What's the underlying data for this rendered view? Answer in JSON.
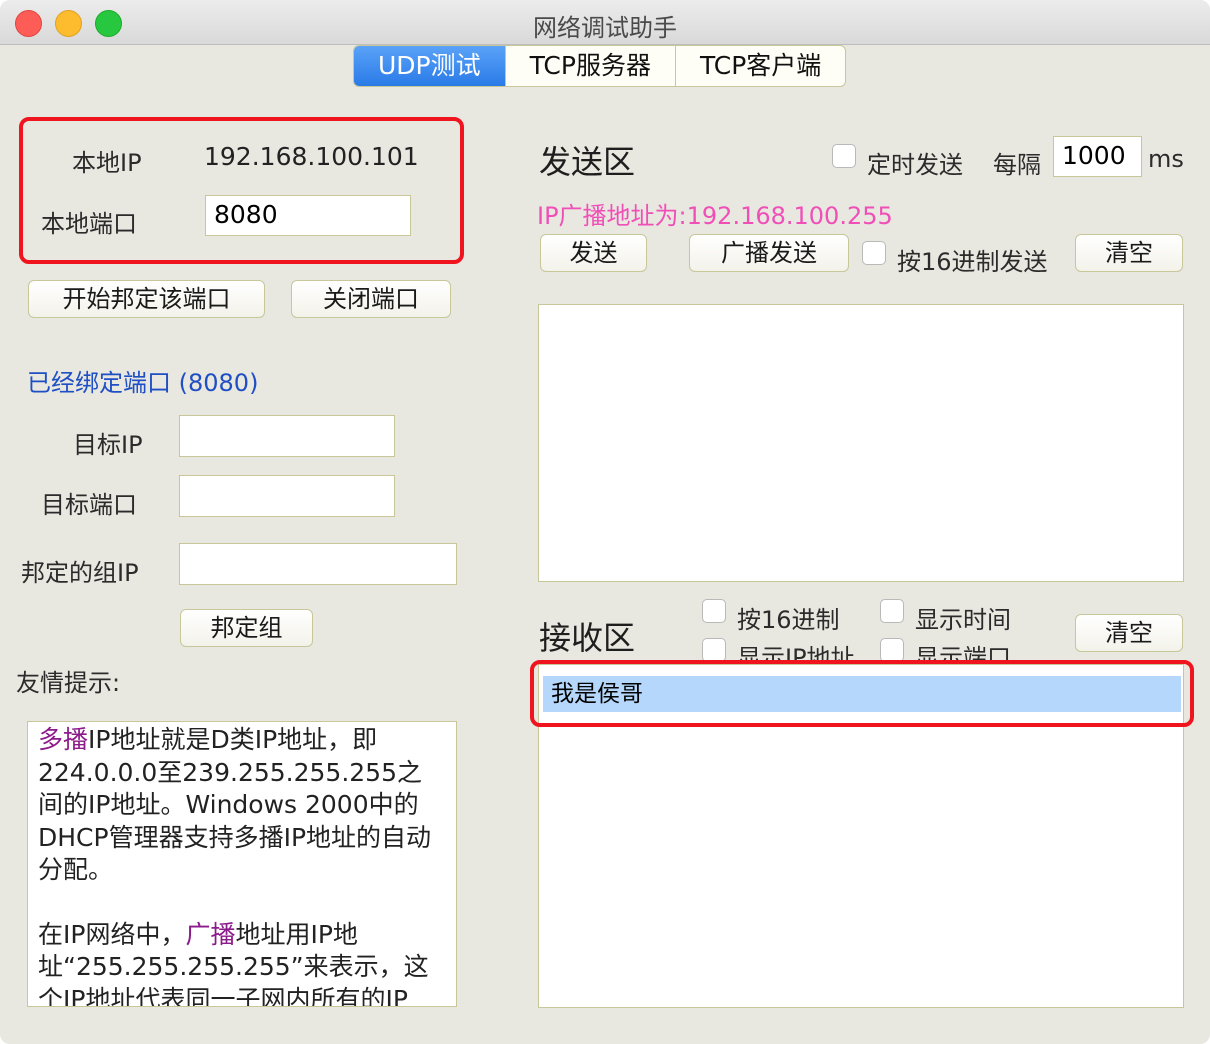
{
  "window": {
    "title": "网络调试助手"
  },
  "tabs": [
    {
      "label": "UDP测试",
      "active": true
    },
    {
      "label": "TCP服务器",
      "active": false
    },
    {
      "label": "TCP客户端",
      "active": false
    }
  ],
  "local": {
    "ip_label": "本地IP",
    "ip_value": "192.168.100.101",
    "port_label": "本地端口",
    "port_value": "8080"
  },
  "bind_buttons": {
    "start": "开始邦定该端口",
    "close": "关闭端口"
  },
  "status": {
    "bound_text": "已经绑定端口 (8080)",
    "color": "#1f4fc4"
  },
  "target": {
    "ip_label": "目标IP",
    "ip_value": "",
    "port_label": "目标端口",
    "port_value": "",
    "group_label": "邦定的组IP",
    "group_value": ""
  },
  "group_button": "邦定组",
  "tips": {
    "title": "友情提示:",
    "p1_hl": "多播",
    "p1_rest": "IP地址就是D类IP地址，即224.0.0.0至239.255.255.255之间的IP地址。Windows 2000中的DHCP管理器支持多播IP地址的自动分配。",
    "p2_start": "在IP网络中，",
    "p2_hl": "广播",
    "p2_rest": "地址用IP地址“255.255.255.255”来表示，这个IP地址代表同一子网内所有的IP"
  },
  "send": {
    "title": "发送区",
    "timed_label": "定时发送",
    "interval_label": "每隔",
    "interval_value": "1000",
    "unit": "ms",
    "broadcast_info": "IP广播地址为:192.168.100.255",
    "broadcast_color": "#f04fb8",
    "send_button": "发送",
    "broadcast_button": "广播发送",
    "hex_label": "按16进制发送",
    "clear_button": "清空",
    "content": ""
  },
  "receive": {
    "title": "接收区",
    "hex_label": "按16进制",
    "show_time_label": "显示时间",
    "show_ip_label": "显示IP地址",
    "show_port_label": "显示端口",
    "clear_button": "清空",
    "messages": [
      "我是侯哥"
    ]
  }
}
